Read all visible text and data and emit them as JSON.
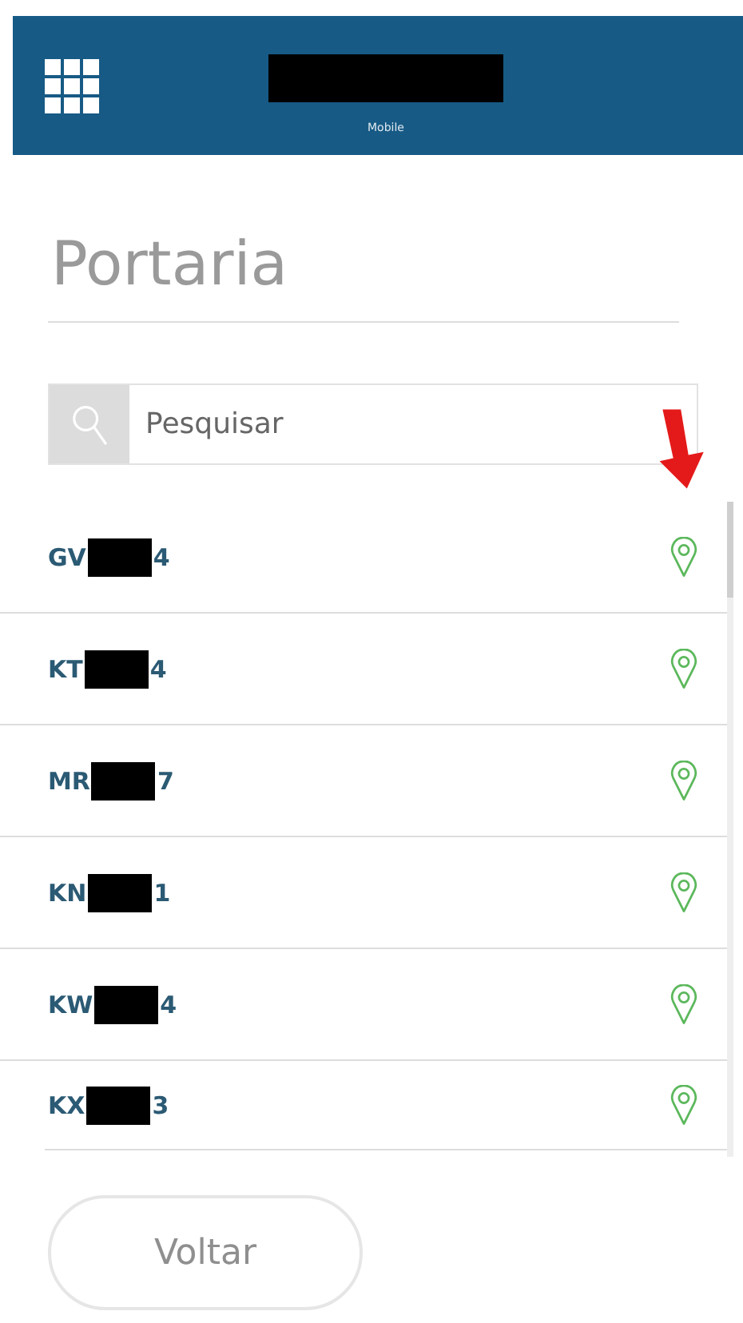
{
  "header": {
    "subtitle": "Mobile"
  },
  "page": {
    "title": "Portaria"
  },
  "search": {
    "placeholder": "Pesquisar"
  },
  "vehicles": [
    {
      "prefix": "GV",
      "suffix": "4"
    },
    {
      "prefix": "KT",
      "suffix": "4"
    },
    {
      "prefix": "MR",
      "suffix": "7"
    },
    {
      "prefix": "KN",
      "suffix": "1"
    },
    {
      "prefix": "KW",
      "suffix": "4"
    },
    {
      "prefix": "KX",
      "suffix": "3"
    }
  ],
  "buttons": {
    "back": "Voltar"
  }
}
